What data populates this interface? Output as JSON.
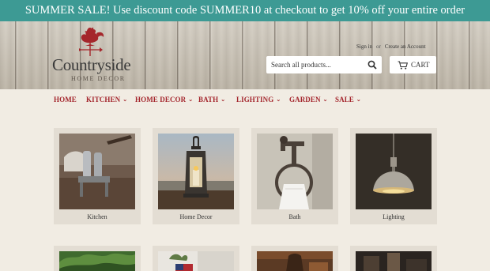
{
  "announcement": "SUMMER SALE! Use discount code SUMMER10 at checkout to get 10% off your entire order",
  "logo": {
    "name": "Countryside",
    "tagline": "HOME DECOR"
  },
  "account": {
    "sign_in": "Sign in",
    "or": "or",
    "create": "Create an Account"
  },
  "search": {
    "placeholder": "Search all products..."
  },
  "cart": {
    "label": "CART"
  },
  "nav": [
    "HOME",
    "KITCHEN",
    "HOME DECOR",
    "BATH",
    "LIGHTING",
    "GARDEN",
    "SALE"
  ],
  "categories": [
    "Kitchen",
    "Home Decor",
    "Bath",
    "Lighting"
  ],
  "colors": {
    "announcement_bg": "#3d9a94",
    "nav_text": "#a4262d",
    "page_bg": "#f1ece3"
  }
}
